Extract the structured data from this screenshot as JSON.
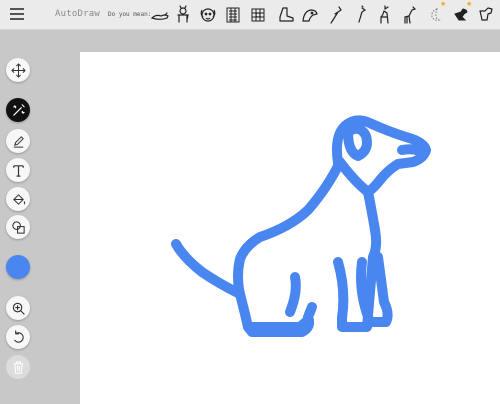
{
  "app": {
    "title": "AutoDraw"
  },
  "suggestions": {
    "label": "Do you mean:",
    "items": [
      {
        "name": "suggest-dog-lying-icon"
      },
      {
        "name": "suggest-dog-standing-icon"
      },
      {
        "name": "suggest-dog-face-icon"
      },
      {
        "name": "suggest-dog-sketch-icon"
      },
      {
        "name": "suggest-dog-pattern-icon"
      },
      {
        "name": "suggest-boot-icon"
      },
      {
        "name": "suggest-bird-head-icon"
      },
      {
        "name": "suggest-horse-icon"
      },
      {
        "name": "suggest-giraffe-head-icon"
      },
      {
        "name": "suggest-deer-icon"
      },
      {
        "name": "suggest-giraffe-icon"
      },
      {
        "name": "suggest-moon-icon"
      },
      {
        "name": "suggest-dog-sitting-icon"
      },
      {
        "name": "suggest-dog-outline-icon"
      }
    ]
  },
  "toolbar": {
    "tools": [
      {
        "name": "move-tool",
        "icon": "move-icon"
      },
      {
        "name": "autodraw-tool",
        "icon": "autodraw-icon"
      },
      {
        "name": "draw-tool",
        "icon": "pencil-icon"
      },
      {
        "name": "type-tool",
        "icon": "text-icon"
      },
      {
        "name": "fill-tool",
        "icon": "fill-bucket-icon"
      },
      {
        "name": "shape-tool",
        "icon": "shapes-icon"
      },
      {
        "name": "zoom-tool",
        "icon": "zoom-in-icon"
      },
      {
        "name": "undo-tool",
        "icon": "undo-icon"
      },
      {
        "name": "delete-tool",
        "icon": "trash-icon"
      }
    ],
    "active_tool": "autodraw-tool",
    "color": "#4a86f0"
  },
  "canvas": {
    "background": "#ffffff",
    "drawing": "dog",
    "stroke_color": "#4a86f0"
  }
}
